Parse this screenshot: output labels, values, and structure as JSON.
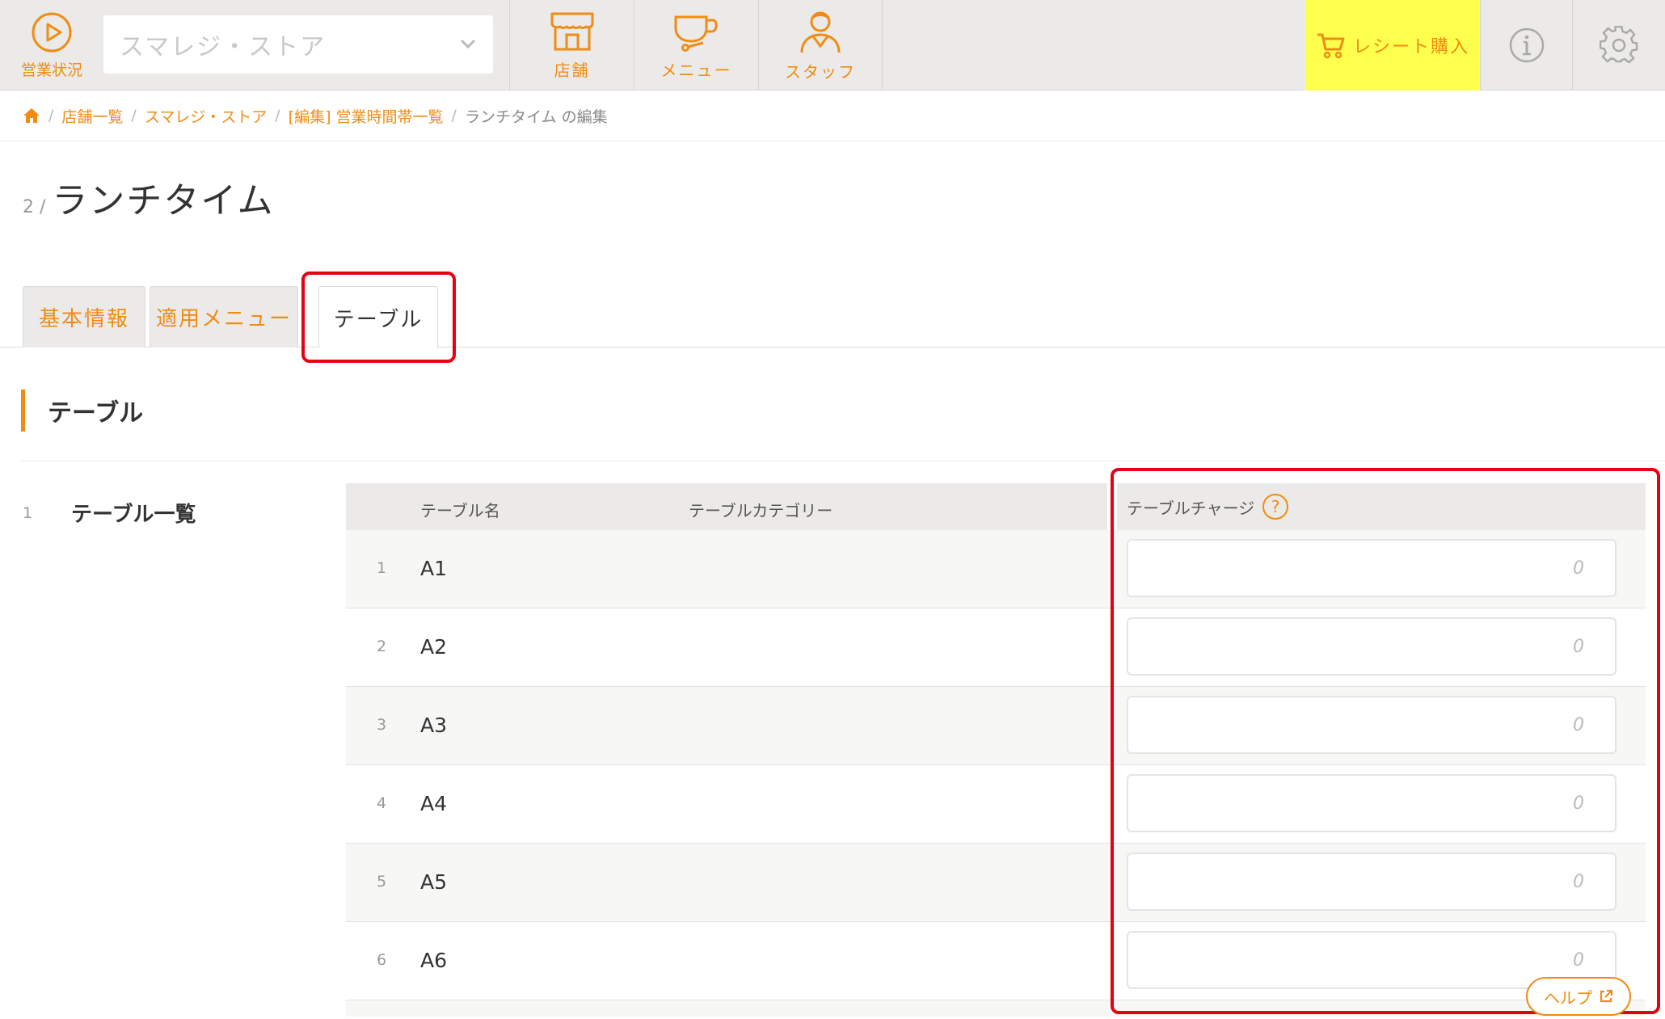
{
  "nav": {
    "status_label": "営業状況",
    "store_select_value": "スマレジ・ストア",
    "items": [
      {
        "label": "店舗",
        "icon": "storefront-icon"
      },
      {
        "label": "メニュー",
        "icon": "teacup-icon"
      },
      {
        "label": "スタッフ",
        "icon": "staff-icon"
      }
    ],
    "receipt_label": "レシート購入",
    "accent_color": "#f08c14",
    "receipt_bg_color": "#ffff4d"
  },
  "breadcrumb": {
    "items": [
      "店舗一覧",
      "スマレジ・ストア",
      "[編集] 営業時間帯一覧"
    ],
    "current": "ランチタイム の編集",
    "separator": "/"
  },
  "page": {
    "number": "2 /",
    "title": "ランチタイム"
  },
  "tabs": [
    {
      "label": "基本情報"
    },
    {
      "label": "適用メニュー"
    },
    {
      "label": "テーブル"
    }
  ],
  "section": {
    "title": "テーブル",
    "row_number": "1",
    "row_label": "テーブル一覧"
  },
  "table": {
    "headers": {
      "name": "テーブル名",
      "category": "テーブルカテゴリー",
      "charge": "テーブルチャージ",
      "help_mark": "?"
    },
    "rows": [
      {
        "index": "1",
        "name": "A1",
        "charge_value": "",
        "charge_placeholder": "0"
      },
      {
        "index": "2",
        "name": "A2",
        "charge_value": "",
        "charge_placeholder": "0"
      },
      {
        "index": "3",
        "name": "A3",
        "charge_value": "",
        "charge_placeholder": "0"
      },
      {
        "index": "4",
        "name": "A4",
        "charge_value": "",
        "charge_placeholder": "0"
      },
      {
        "index": "5",
        "name": "A5",
        "charge_value": "",
        "charge_placeholder": "0"
      },
      {
        "index": "6",
        "name": "A6",
        "charge_value": "",
        "charge_placeholder": "0"
      }
    ]
  },
  "help": {
    "label": "ヘルプ"
  },
  "highlight_color": "#e60012"
}
